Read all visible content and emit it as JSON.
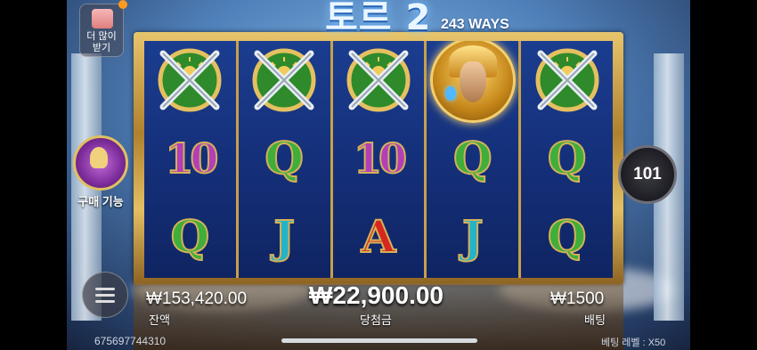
{
  "game": {
    "title": "토르 2",
    "ways": "243 WAYS"
  },
  "left_panel": {
    "more_button_label_line1": "더 많이",
    "more_button_label_line2": "받기",
    "buy_feature_label": "구매 기능"
  },
  "reels": [
    [
      "crossed-swords-shield",
      "10",
      "Q"
    ],
    [
      "crossed-swords-shield",
      "Q",
      "J"
    ],
    [
      "crossed-swords-shield",
      "10",
      "A"
    ],
    [
      "thor-hero",
      "Q",
      "J"
    ],
    [
      "crossed-swords-shield",
      "Q",
      "Q"
    ]
  ],
  "symbol_colors": {
    "10": "#b23fb8",
    "Q": "#3fae3a",
    "J": "#24b3c8",
    "A": "#d6271f"
  },
  "spin": {
    "auto_count": "101"
  },
  "stats": {
    "balance_value": "₩153,420.00",
    "balance_label": "잔액",
    "win_value": "₩22,900.00",
    "win_label": "당첨금",
    "bet_value": "₩1500",
    "bet_label": "배팅"
  },
  "footer": {
    "session_id": "675697744310",
    "bet_level": "베팅 레벨 : X50"
  }
}
